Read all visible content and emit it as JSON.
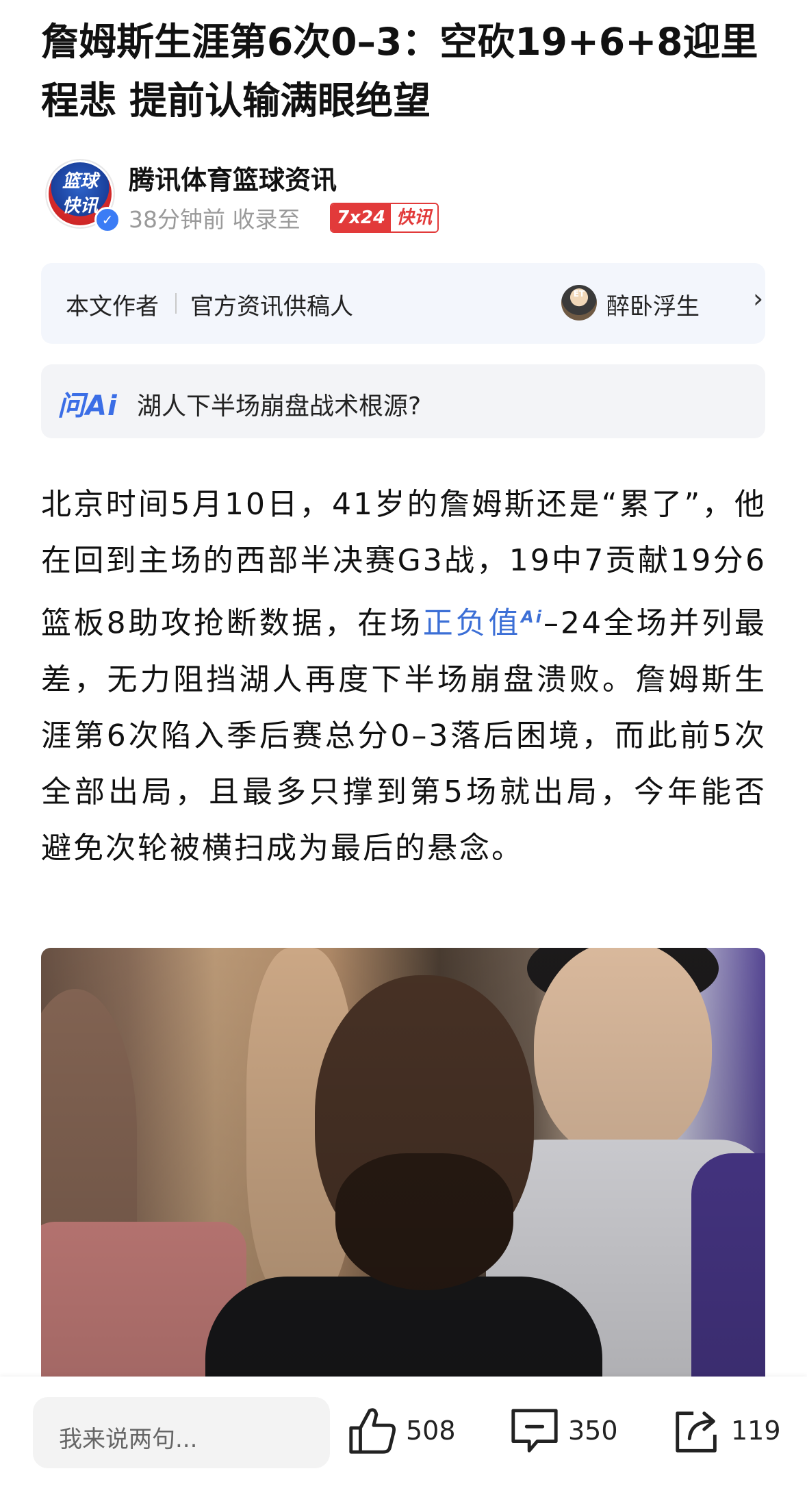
{
  "article": {
    "title": "詹姆斯生涯第6次0–3：空砍19+6+8迎里程悲 提前认输满眼绝望",
    "body_part1": "北京时间5月10日，41岁的詹姆斯还是“累了”，他在回到主场的西部半决赛G3战，19中7贡献19分6篮板8助攻抢断数据，在场",
    "body_link": "正负值",
    "body_ai_mark": "Ai",
    "body_part2": "–24全场并列最差，无力阻挡湖人再度下半场崩盘溃败。詹姆斯生涯第6次陷入季后赛总分0–3落后困境，而此前5次全部出局，且最多只撑到第5场就出局，今年能否避免次轮被横扫成为最后的悬念。"
  },
  "source": {
    "avatar_line1": "篮球",
    "avatar_line2": "快讯",
    "name": "腾讯体育篮球资讯",
    "meta": "38分钟前 收录至",
    "badge_left": "7x24",
    "badge_right": "快讯"
  },
  "author_card": {
    "label": "本文作者",
    "role": "官方资讯供稿人",
    "avatar_text": "ET",
    "pen_name": "醉卧浮生"
  },
  "ask_ai": {
    "logo": "问Ai",
    "question": "湖人下半场崩盘战术根源?"
  },
  "bottom_bar": {
    "comment_placeholder": "我来说两句...",
    "likes": "508",
    "comments": "350",
    "shares": "119"
  },
  "icons": [
    "verified-icon",
    "chevron-right-icon",
    "thumbs-up-icon",
    "comment-icon",
    "share-icon"
  ]
}
